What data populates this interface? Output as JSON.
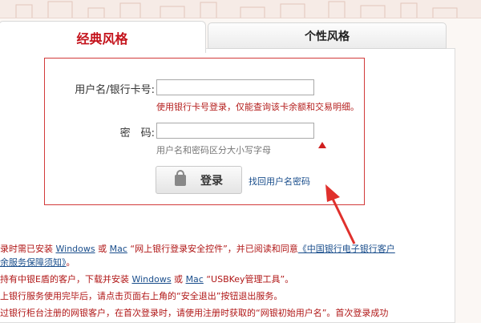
{
  "tabs": {
    "classic": "经典风格",
    "personal": "个性风格"
  },
  "login": {
    "username_label": "用户名/银行卡号:",
    "username_value": "",
    "username_hint": "使用银行卡号登录，仅能查询该卡余额和交易明细。",
    "password_label": "密　码:",
    "password_value": "",
    "password_hint": "用户名和密码区分大小写字母",
    "login_button": "登录",
    "forgot_link": "找回用户名密码"
  },
  "notes": [
    {
      "a": "录时需已安装 ",
      "link1": "Windows",
      "b": " 或 ",
      "link2": "Mac",
      "c": " “网上银行登录安全控件”，并已阅读和同意",
      "link3": "《中国银行电子银行客户"
    },
    {
      "link4": "余服务保障须知》",
      "a": "。"
    },
    {
      "a": "持有中银E盾的客户，下载并安装 ",
      "link1": "Windows",
      "b": " 或 ",
      "link2": "Mac",
      "c": " “USBKey管理工具”。"
    },
    {
      "a": "上银行服务使用完毕后，请点击页面右上角的“安全退出”按钮退出服务。"
    },
    {
      "a": "过银行柜台注册的网银客户，在首次登录时，请使用注册时获取的“网银初始用户名”。首次登录成功"
    }
  ],
  "colors": {
    "accent_red": "#c4121b",
    "link_blue": "#1a4e8c",
    "box_border": "#d23a3a"
  }
}
